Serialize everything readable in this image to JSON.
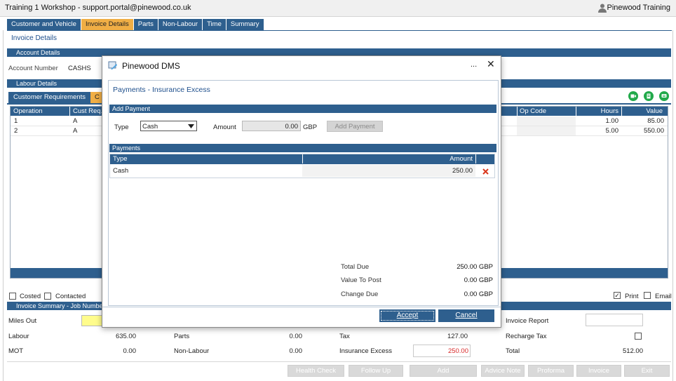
{
  "window": {
    "title": "Training 1 Workshop - support.portal@pinewood.co.uk",
    "user": "Pinewood Training"
  },
  "tabs": [
    "Customer and Vehicle",
    "Invoice Details",
    "Parts",
    "Non-Labour",
    "Time",
    "Summary"
  ],
  "invoice_details_link": "Invoice Details",
  "account": {
    "section": "Account Details",
    "label": "Account Number",
    "value": "CASHS"
  },
  "labour": {
    "section": "Labour Details",
    "subtabs": [
      "Customer Requirements",
      "C"
    ],
    "columns": [
      "Operation",
      "Cust Req.",
      "Op Code",
      "Hours",
      "Value"
    ],
    "rows": [
      {
        "operation": "1",
        "cust_req": "A",
        "hours": "1.00",
        "value": "85.00"
      },
      {
        "operation": "2",
        "cust_req": "A",
        "hours": "5.00",
        "value": "550.00"
      }
    ]
  },
  "flags": {
    "costed": "Costed",
    "contacted": "Contacted",
    "print": "Print",
    "email": "Email"
  },
  "summary": {
    "section": "Invoice Summary - Job Numbe",
    "miles_out": "Miles Out",
    "labour_label": "Labour",
    "labour_value": "635.00",
    "mot_label": "MOT",
    "mot_value": "0.00",
    "parts_label": "Parts",
    "parts_value": "0.00",
    "nonlabour_label": "Non-Labour",
    "nonlabour_value": "0.00",
    "tax_label": "Tax",
    "tax_value": "127.00",
    "insurance_label": "Insurance Excess",
    "insurance_value": "250.00",
    "invoice_report": "Invoice Report",
    "recharge_tax": "Recharge Tax",
    "total_label": "Total",
    "total_value": "512.00"
  },
  "bottom_buttons": [
    "Health Check",
    "Follow Up",
    "Add",
    "Advice Note",
    "Proforma",
    "Invoice",
    "Exit"
  ],
  "dialog": {
    "title": "Pinewood DMS",
    "more": "...",
    "close": "✕",
    "heading": "Payments - Insurance Excess",
    "add_section": "Add Payment",
    "type_label": "Type",
    "type_value": "Cash",
    "amount_label": "Amount",
    "amount_value": "0.00",
    "currency": "GBP",
    "add_button": "Add Payment",
    "payments_section": "Payments",
    "columns": [
      "Type",
      "Amount"
    ],
    "payments": [
      {
        "type": "Cash",
        "amount": "250.00"
      }
    ],
    "total_due_label": "Total Due",
    "total_due_value": "250.00 GBP",
    "value_to_post_label": "Value To Post",
    "value_to_post_value": "0.00 GBP",
    "change_due_label": "Change Due",
    "change_due_value": "0.00 GBP",
    "accept": "Accept",
    "cancel": "Cancel"
  },
  "colors": {
    "primary": "#2e5f8e",
    "active_tab": "#f0ae45",
    "delete": "#d9381e",
    "action_green": "#21a94a"
  }
}
